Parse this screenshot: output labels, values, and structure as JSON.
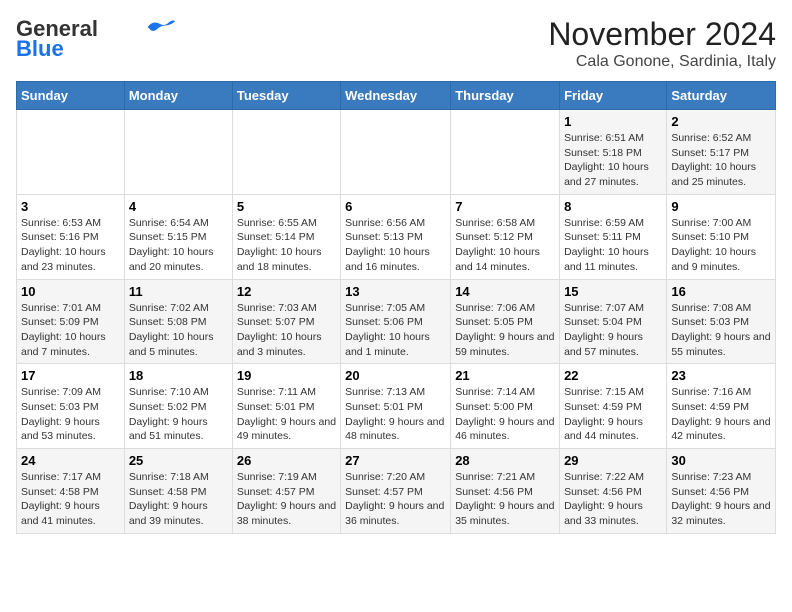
{
  "logo": {
    "line1": "General",
    "line2": "Blue"
  },
  "title": "November 2024",
  "subtitle": "Cala Gonone, Sardinia, Italy",
  "weekdays": [
    "Sunday",
    "Monday",
    "Tuesday",
    "Wednesday",
    "Thursday",
    "Friday",
    "Saturday"
  ],
  "weeks": [
    [
      {
        "day": "",
        "content": ""
      },
      {
        "day": "",
        "content": ""
      },
      {
        "day": "",
        "content": ""
      },
      {
        "day": "",
        "content": ""
      },
      {
        "day": "",
        "content": ""
      },
      {
        "day": "1",
        "content": "Sunrise: 6:51 AM\nSunset: 5:18 PM\nDaylight: 10 hours and 27 minutes."
      },
      {
        "day": "2",
        "content": "Sunrise: 6:52 AM\nSunset: 5:17 PM\nDaylight: 10 hours and 25 minutes."
      }
    ],
    [
      {
        "day": "3",
        "content": "Sunrise: 6:53 AM\nSunset: 5:16 PM\nDaylight: 10 hours and 23 minutes."
      },
      {
        "day": "4",
        "content": "Sunrise: 6:54 AM\nSunset: 5:15 PM\nDaylight: 10 hours and 20 minutes."
      },
      {
        "day": "5",
        "content": "Sunrise: 6:55 AM\nSunset: 5:14 PM\nDaylight: 10 hours and 18 minutes."
      },
      {
        "day": "6",
        "content": "Sunrise: 6:56 AM\nSunset: 5:13 PM\nDaylight: 10 hours and 16 minutes."
      },
      {
        "day": "7",
        "content": "Sunrise: 6:58 AM\nSunset: 5:12 PM\nDaylight: 10 hours and 14 minutes."
      },
      {
        "day": "8",
        "content": "Sunrise: 6:59 AM\nSunset: 5:11 PM\nDaylight: 10 hours and 11 minutes."
      },
      {
        "day": "9",
        "content": "Sunrise: 7:00 AM\nSunset: 5:10 PM\nDaylight: 10 hours and 9 minutes."
      }
    ],
    [
      {
        "day": "10",
        "content": "Sunrise: 7:01 AM\nSunset: 5:09 PM\nDaylight: 10 hours and 7 minutes."
      },
      {
        "day": "11",
        "content": "Sunrise: 7:02 AM\nSunset: 5:08 PM\nDaylight: 10 hours and 5 minutes."
      },
      {
        "day": "12",
        "content": "Sunrise: 7:03 AM\nSunset: 5:07 PM\nDaylight: 10 hours and 3 minutes."
      },
      {
        "day": "13",
        "content": "Sunrise: 7:05 AM\nSunset: 5:06 PM\nDaylight: 10 hours and 1 minute."
      },
      {
        "day": "14",
        "content": "Sunrise: 7:06 AM\nSunset: 5:05 PM\nDaylight: 9 hours and 59 minutes."
      },
      {
        "day": "15",
        "content": "Sunrise: 7:07 AM\nSunset: 5:04 PM\nDaylight: 9 hours and 57 minutes."
      },
      {
        "day": "16",
        "content": "Sunrise: 7:08 AM\nSunset: 5:03 PM\nDaylight: 9 hours and 55 minutes."
      }
    ],
    [
      {
        "day": "17",
        "content": "Sunrise: 7:09 AM\nSunset: 5:03 PM\nDaylight: 9 hours and 53 minutes."
      },
      {
        "day": "18",
        "content": "Sunrise: 7:10 AM\nSunset: 5:02 PM\nDaylight: 9 hours and 51 minutes."
      },
      {
        "day": "19",
        "content": "Sunrise: 7:11 AM\nSunset: 5:01 PM\nDaylight: 9 hours and 49 minutes."
      },
      {
        "day": "20",
        "content": "Sunrise: 7:13 AM\nSunset: 5:01 PM\nDaylight: 9 hours and 48 minutes."
      },
      {
        "day": "21",
        "content": "Sunrise: 7:14 AM\nSunset: 5:00 PM\nDaylight: 9 hours and 46 minutes."
      },
      {
        "day": "22",
        "content": "Sunrise: 7:15 AM\nSunset: 4:59 PM\nDaylight: 9 hours and 44 minutes."
      },
      {
        "day": "23",
        "content": "Sunrise: 7:16 AM\nSunset: 4:59 PM\nDaylight: 9 hours and 42 minutes."
      }
    ],
    [
      {
        "day": "24",
        "content": "Sunrise: 7:17 AM\nSunset: 4:58 PM\nDaylight: 9 hours and 41 minutes."
      },
      {
        "day": "25",
        "content": "Sunrise: 7:18 AM\nSunset: 4:58 PM\nDaylight: 9 hours and 39 minutes."
      },
      {
        "day": "26",
        "content": "Sunrise: 7:19 AM\nSunset: 4:57 PM\nDaylight: 9 hours and 38 minutes."
      },
      {
        "day": "27",
        "content": "Sunrise: 7:20 AM\nSunset: 4:57 PM\nDaylight: 9 hours and 36 minutes."
      },
      {
        "day": "28",
        "content": "Sunrise: 7:21 AM\nSunset: 4:56 PM\nDaylight: 9 hours and 35 minutes."
      },
      {
        "day": "29",
        "content": "Sunrise: 7:22 AM\nSunset: 4:56 PM\nDaylight: 9 hours and 33 minutes."
      },
      {
        "day": "30",
        "content": "Sunrise: 7:23 AM\nSunset: 4:56 PM\nDaylight: 9 hours and 32 minutes."
      }
    ]
  ]
}
